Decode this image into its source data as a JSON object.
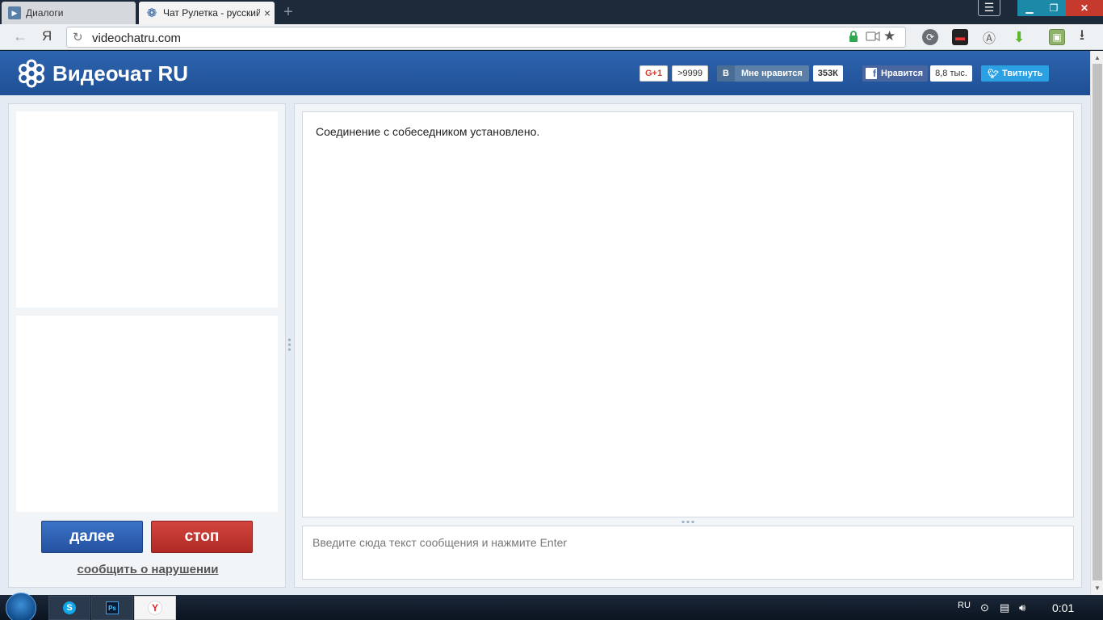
{
  "browser": {
    "tabs": [
      {
        "title": "Диалоги",
        "active": false
      },
      {
        "title": "Чат Рулетка - русский"
      }
    ],
    "url": "videochatru.com",
    "yandex_button": "Я"
  },
  "site": {
    "logo_text": "Видеочат RU",
    "social": {
      "gplus_label": "G+1",
      "gplus_count": ">9999",
      "vk_logo": "В",
      "vk_label": "Мне нравится",
      "vk_count": "353К",
      "fb_label": "Нравится",
      "fb_count": "8,8 тыс.",
      "tw_label": "Твитнуть"
    },
    "controls": {
      "next_label": "далее",
      "stop_label": "стоп",
      "report_label": "сообщить о нарушении"
    },
    "chat": {
      "status_message": "Соединение с собеседником установлено.",
      "input_placeholder": "Введите сюда текст сообщения и нажмите Enter"
    }
  },
  "taskbar": {
    "skype_glyph": "S",
    "photoshop_glyph": "Ps",
    "yandex_glyph": "Y",
    "language": "RU",
    "clock": "0:01"
  },
  "colors": {
    "header_blue": "#2559a3",
    "next_button": "#2f62b5",
    "stop_button": "#c23a33",
    "panel_bg": "#f2f5f8"
  }
}
